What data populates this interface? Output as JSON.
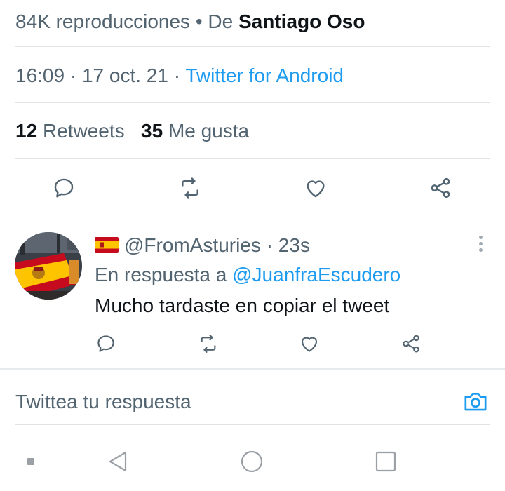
{
  "tweet": {
    "views_text": "84K reproducciones",
    "bullet": "•",
    "by_label": "De",
    "author": "Santiago Oso",
    "time": "16:09",
    "dot": "·",
    "date": "17 oct. 21",
    "source": "Twitter for Android",
    "retweets_count": "12",
    "retweets_label": "Retweets",
    "likes_count": "35",
    "likes_label": "Me gusta",
    "actions": [
      "reply-icon",
      "retweet-icon",
      "like-icon",
      "share-icon"
    ]
  },
  "reply": {
    "flag": "spain-flag-icon",
    "handle": "@FromAsturies",
    "dot": "·",
    "time": "23s",
    "in_reply_label": "En respuesta a",
    "in_reply_handle": "@JuanfraEscudero",
    "text": "Mucho tardaste en copiar el tweet",
    "actions": [
      "reply-icon",
      "retweet-icon",
      "like-icon",
      "share-icon"
    ]
  },
  "compose": {
    "placeholder": "Twittea tu respuesta",
    "camera": "camera-icon"
  },
  "navbar": {
    "items": [
      "recent-apps-icon",
      "back-icon",
      "home-icon",
      "overview-icon"
    ]
  },
  "colors": {
    "accent": "#1d9bf0",
    "text": "#0f1419",
    "muted": "#536471",
    "divider": "#dfe3e6"
  }
}
